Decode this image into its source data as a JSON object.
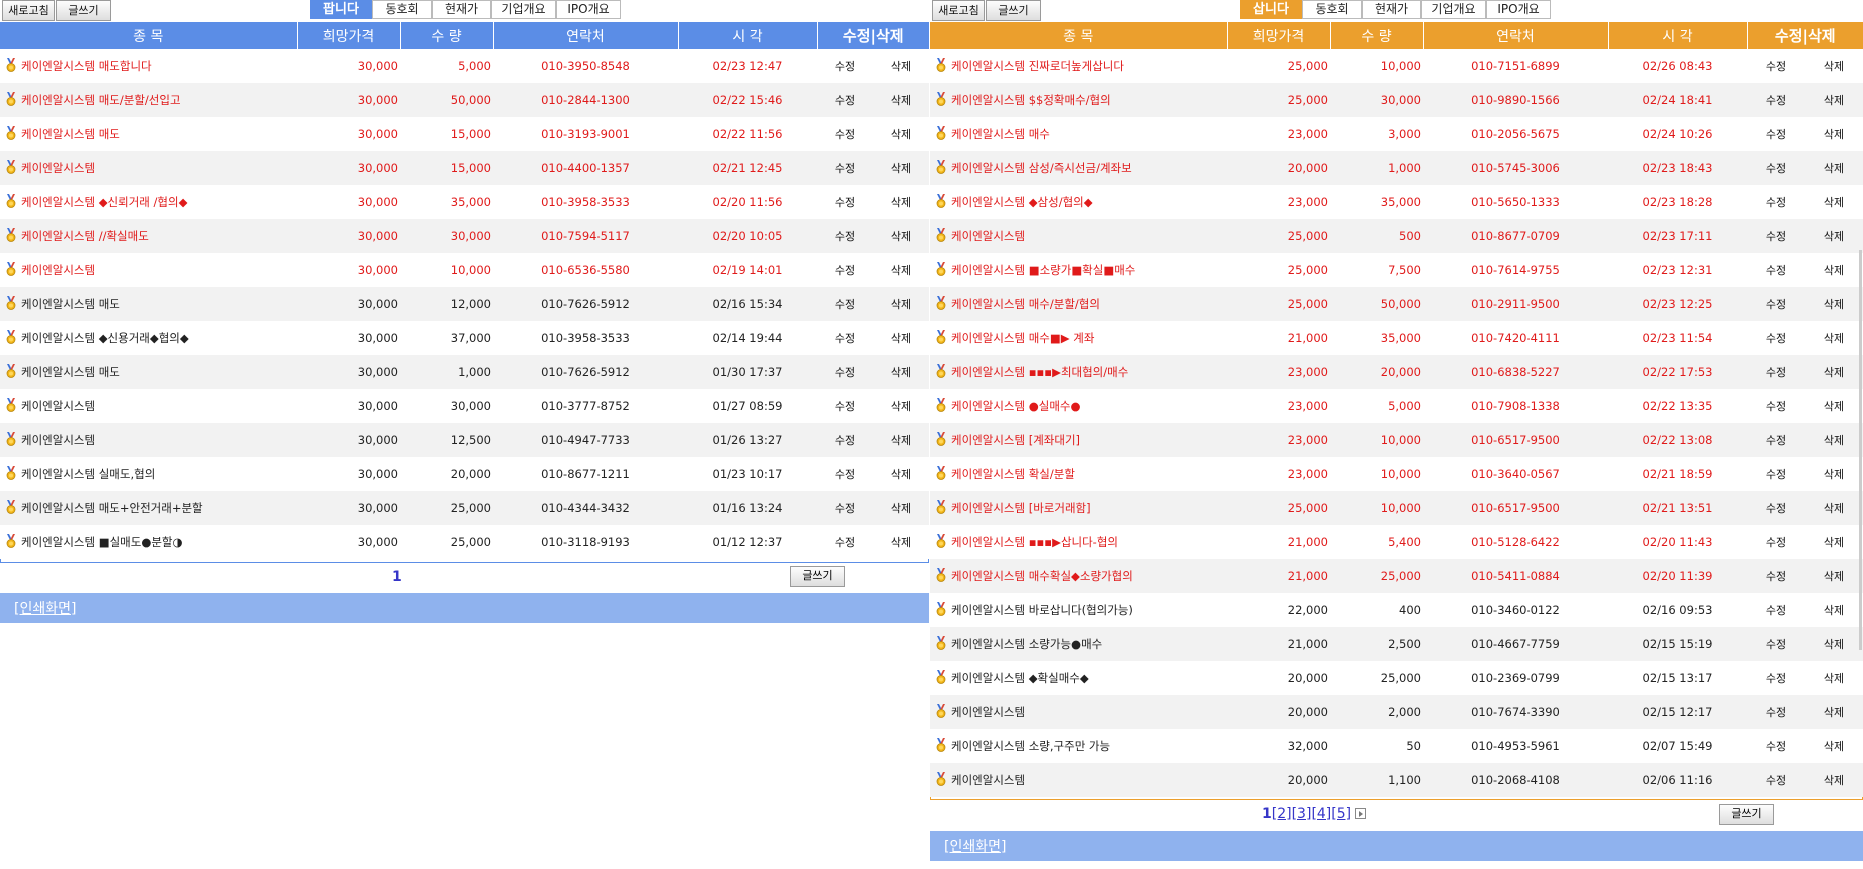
{
  "sell": {
    "refresh_label": "새로고침",
    "write_label": "글쓰기",
    "tabs": [
      "팝니다",
      "동호회",
      "현재가",
      "기업개요",
      "IPO개요"
    ],
    "headers": {
      "item": "종 목",
      "price": "희망가격",
      "qty": "수 량",
      "contact": "연락처",
      "time": "시 각",
      "edit": "수정|삭제"
    },
    "edit_label": "수정",
    "delete_label": "삭제",
    "rows": [
      {
        "title": "케이엔알시스템 매도합니다",
        "price": "30,000",
        "qty": "5,000",
        "contact": "010-3950-8548",
        "time": "02/23 12:47",
        "hl": true
      },
      {
        "title": "케이엔알시스템 매도/분할/선입고",
        "price": "30,000",
        "qty": "50,000",
        "contact": "010-2844-1300",
        "time": "02/22 15:46",
        "hl": true
      },
      {
        "title": "케이엔알시스템 매도",
        "price": "30,000",
        "qty": "15,000",
        "contact": "010-3193-9001",
        "time": "02/22 11:56",
        "hl": true
      },
      {
        "title": "케이엔알시스템",
        "price": "30,000",
        "qty": "15,000",
        "contact": "010-4400-1357",
        "time": "02/21 12:45",
        "hl": true
      },
      {
        "title": "케이엔알시스템 ◆신뢰거래 /협의◆",
        "price": "30,000",
        "qty": "35,000",
        "contact": "010-3958-3533",
        "time": "02/20 11:56",
        "hl": true
      },
      {
        "title": "케이엔알시스템 //확실매도",
        "price": "30,000",
        "qty": "30,000",
        "contact": "010-7594-5117",
        "time": "02/20 10:05",
        "hl": true
      },
      {
        "title": "케이엔알시스템",
        "price": "30,000",
        "qty": "10,000",
        "contact": "010-6536-5580",
        "time": "02/19 14:01",
        "hl": true
      },
      {
        "title": "케이엔알시스템 매도",
        "price": "30,000",
        "qty": "12,000",
        "contact": "010-7626-5912",
        "time": "02/16 15:34",
        "hl": false
      },
      {
        "title": "케이엔알시스템 ◆신용거래◆협의◆",
        "price": "30,000",
        "qty": "37,000",
        "contact": "010-3958-3533",
        "time": "02/14 19:44",
        "hl": false
      },
      {
        "title": "케이엔알시스템 매도",
        "price": "30,000",
        "qty": "1,000",
        "contact": "010-7626-5912",
        "time": "01/30 17:37",
        "hl": false
      },
      {
        "title": "케이엔알시스템",
        "price": "30,000",
        "qty": "30,000",
        "contact": "010-3777-8752",
        "time": "01/27 08:59",
        "hl": false
      },
      {
        "title": "케이엔알시스템",
        "price": "30,000",
        "qty": "12,500",
        "contact": "010-4947-7733",
        "time": "01/26 13:27",
        "hl": false
      },
      {
        "title": "케이엔알시스템 실매도,협의",
        "price": "30,000",
        "qty": "20,000",
        "contact": "010-8677-1211",
        "time": "01/23 10:17",
        "hl": false
      },
      {
        "title": "케이엔알시스템 매도+안전거래+분할",
        "price": "30,000",
        "qty": "25,000",
        "contact": "010-4344-3432",
        "time": "01/16 13:24",
        "hl": false
      },
      {
        "title": "케이엔알시스템 ■실매도●분할◑",
        "price": "30,000",
        "qty": "25,000",
        "contact": "010-3118-9193",
        "time": "01/12 12:37",
        "hl": false
      }
    ],
    "pager": {
      "current": "1"
    },
    "print_label": "[인쇄화면]"
  },
  "buy": {
    "refresh_label": "새로고침",
    "write_label": "글쓰기",
    "tabs": [
      "삽니다",
      "동호회",
      "현재가",
      "기업개요",
      "IPO개요"
    ],
    "headers": {
      "item": "종 목",
      "price": "희망가격",
      "qty": "수 량",
      "contact": "연락처",
      "time": "시 각",
      "edit": "수정|삭제"
    },
    "edit_label": "수정",
    "delete_label": "삭제",
    "rows": [
      {
        "title": "케이엔알시스템 진짜로더높게삽니다",
        "price": "25,000",
        "qty": "10,000",
        "contact": "010-7151-6899",
        "time": "02/26 08:43",
        "hl": true
      },
      {
        "title": "케이엔알시스템 $$정확매수/협의",
        "price": "25,000",
        "qty": "30,000",
        "contact": "010-9890-1566",
        "time": "02/24 18:41",
        "hl": true
      },
      {
        "title": "케이엔알시스템 매수",
        "price": "23,000",
        "qty": "3,000",
        "contact": "010-2056-5675",
        "time": "02/24 10:26",
        "hl": true
      },
      {
        "title": "케이엔알시스템 삼성/즉시선금/계좌보",
        "price": "20,000",
        "qty": "1,000",
        "contact": "010-5745-3006",
        "time": "02/23 18:43",
        "hl": true
      },
      {
        "title": "케이엔알시스템 ◆삼성/협의◆",
        "price": "23,000",
        "qty": "35,000",
        "contact": "010-5650-1333",
        "time": "02/23 18:28",
        "hl": true
      },
      {
        "title": "케이엔알시스템",
        "price": "25,000",
        "qty": "500",
        "contact": "010-8677-0709",
        "time": "02/23 17:11",
        "hl": true
      },
      {
        "title": "케이엔알시스템 ■소량가■확실■매수",
        "price": "25,000",
        "qty": "7,500",
        "contact": "010-7614-9755",
        "time": "02/23 12:31",
        "hl": true
      },
      {
        "title": "케이엔알시스템 매수/분할/협의",
        "price": "25,000",
        "qty": "50,000",
        "contact": "010-2911-9500",
        "time": "02/23 12:25",
        "hl": true
      },
      {
        "title": "케이엔알시스템 매수■▶ 계좌",
        "price": "21,000",
        "qty": "35,000",
        "contact": "010-7420-4111",
        "time": "02/23 11:54",
        "hl": true
      },
      {
        "title": "케이엔알시스템 ▪▪▪▶최대협의/매수",
        "price": "23,000",
        "qty": "20,000",
        "contact": "010-6838-5227",
        "time": "02/22 17:53",
        "hl": true
      },
      {
        "title": "케이엔알시스템 ●실매수●",
        "price": "23,000",
        "qty": "5,000",
        "contact": "010-7908-1338",
        "time": "02/22 13:35",
        "hl": true
      },
      {
        "title": "케이엔알시스템 [계좌대기]",
        "price": "23,000",
        "qty": "10,000",
        "contact": "010-6517-9500",
        "time": "02/22 13:08",
        "hl": true
      },
      {
        "title": "케이엔알시스템 확실/분할",
        "price": "23,000",
        "qty": "10,000",
        "contact": "010-3640-0567",
        "time": "02/21 18:59",
        "hl": true
      },
      {
        "title": "케이엔알시스템 [바로거래함]",
        "price": "25,000",
        "qty": "10,000",
        "contact": "010-6517-9500",
        "time": "02/21 13:51",
        "hl": true
      },
      {
        "title": "케이엔알시스템 ▪▪▪▶삽니다-협의",
        "price": "21,000",
        "qty": "5,400",
        "contact": "010-5128-6422",
        "time": "02/20 11:43",
        "hl": true
      },
      {
        "title": "케이엔알시스템 매수확실◆소량가협의",
        "price": "21,000",
        "qty": "25,000",
        "contact": "010-5411-0884",
        "time": "02/20 11:39",
        "hl": true
      },
      {
        "title": "케이엔알시스템 바로삽니다(협의가능)",
        "price": "22,000",
        "qty": "400",
        "contact": "010-3460-0122",
        "time": "02/16 09:53",
        "hl": false
      },
      {
        "title": "케이엔알시스템 소량가능●매수",
        "price": "21,000",
        "qty": "2,500",
        "contact": "010-4667-7759",
        "time": "02/15 15:19",
        "hl": false
      },
      {
        "title": "케이엔알시스템 ◆확실매수◆",
        "price": "20,000",
        "qty": "25,000",
        "contact": "010-2369-0799",
        "time": "02/15 13:17",
        "hl": false
      },
      {
        "title": "케이엔알시스템",
        "price": "20,000",
        "qty": "2,000",
        "contact": "010-7674-3390",
        "time": "02/15 12:17",
        "hl": false
      },
      {
        "title": "케이엔알시스템 소량,구주만 가능",
        "price": "32,000",
        "qty": "50",
        "contact": "010-4953-5961",
        "time": "02/07 15:49",
        "hl": false
      },
      {
        "title": "케이엔알시스템",
        "price": "20,000",
        "qty": "1,100",
        "contact": "010-2068-4108",
        "time": "02/06 11:16",
        "hl": false
      }
    ],
    "pager": {
      "current": "1",
      "pages": [
        "[2]",
        "[3]",
        "[4]",
        "[5]"
      ]
    },
    "print_label": "[인쇄화면]"
  },
  "colors": {
    "sell_accent": "#5b8de6",
    "buy_accent": "#eb9f2d",
    "highlight_text": "#e01a1a",
    "print_bar": "#8fb2ee"
  }
}
